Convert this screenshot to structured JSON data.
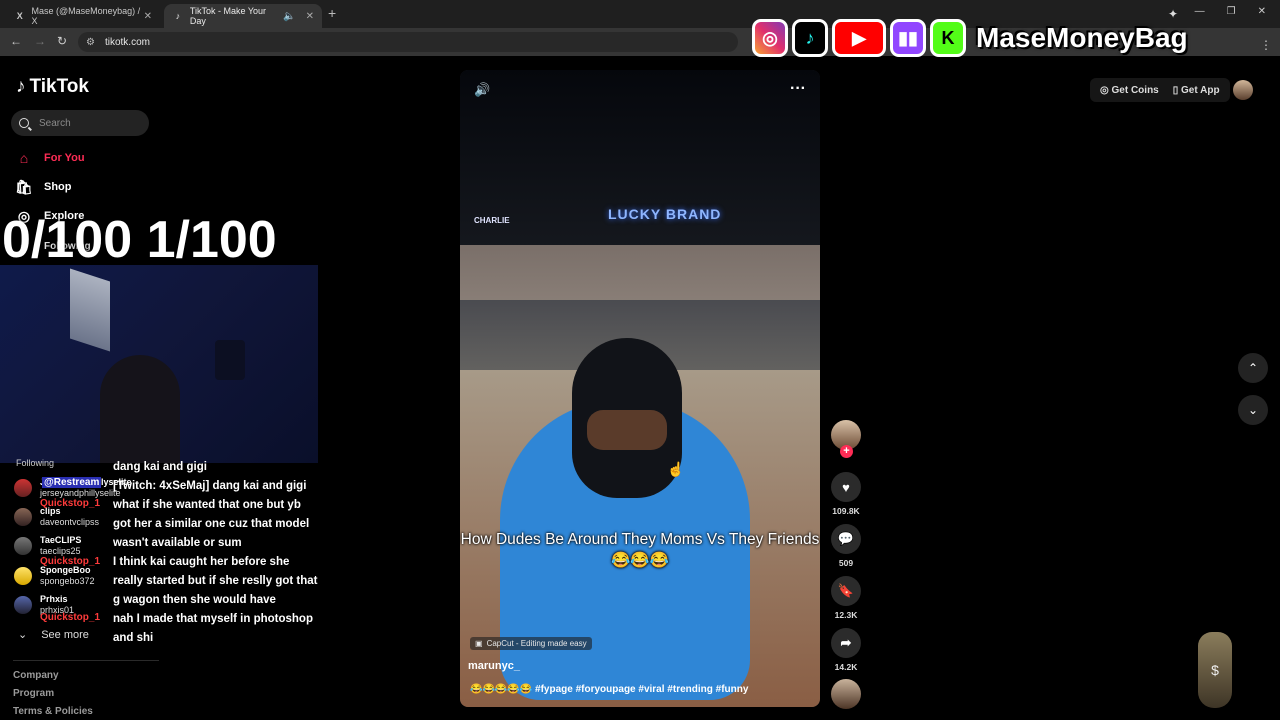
{
  "browser": {
    "tabs": [
      {
        "icon": "X",
        "title": "Mase (@MaseMoneybag) / X"
      },
      {
        "icon": "♪",
        "title": "TikTok - Make Your Day"
      }
    ],
    "url": "tikotk.com"
  },
  "overlay": {
    "counter": "0/100 1/100",
    "brand_name": "MaseMoneyBag"
  },
  "tiktok": {
    "logo": "TikTok",
    "search_placeholder": "Search",
    "nav": {
      "for_you": "For You",
      "shop": "Shop",
      "explore": "Explore",
      "following": "Following"
    },
    "following_label": "Following",
    "following_accounts": [
      {
        "name": "JerseyandPhillyselite",
        "handle": "jerseyandphillyselite"
      },
      {
        "name": "clips",
        "handle": "daveontvclipss"
      },
      {
        "name": "TaeCLIPS",
        "handle": "taeclips25"
      },
      {
        "name": "SpongeBoo",
        "handle": "spongebo372"
      },
      {
        "name": "Prhxis",
        "handle": "prhxis01"
      }
    ],
    "see_more": "See more",
    "footer": [
      "Company",
      "Program",
      "Terms & Policies"
    ],
    "top_right": {
      "get_coins": "Get Coins",
      "get_app": "Get App"
    }
  },
  "chat": {
    "names": [
      "@Restream",
      "Quickstop_1",
      "Quickstop_1",
      "Quickstop_1"
    ],
    "lines": [
      "dang kai and gigi",
      "[Twitch: 4xSeMaj] dang kai and gigi",
      "what if she wanted that one but yb got her a similar one cuz that model wasn't available or sum",
      "I think kai caught her before she really started but if she reslly got that g wagon then she would have",
      "nah I made that myself in photoshop and shi"
    ]
  },
  "video": {
    "caption": "How Dudes  Be Around They Moms Vs They Friends 😂😂😂",
    "capcut": "CapCut - Editing made easy",
    "author": "marunyc_",
    "description": "😂😂😂😂😂 #fypage #foryoupage #viral #trending #funny",
    "sign_text": "LUCKY BRAND",
    "sign_text2": "CHARLIE"
  },
  "actions": {
    "likes": "109.8K",
    "comments": "509",
    "saves": "12.3K",
    "shares": "14.2K"
  }
}
